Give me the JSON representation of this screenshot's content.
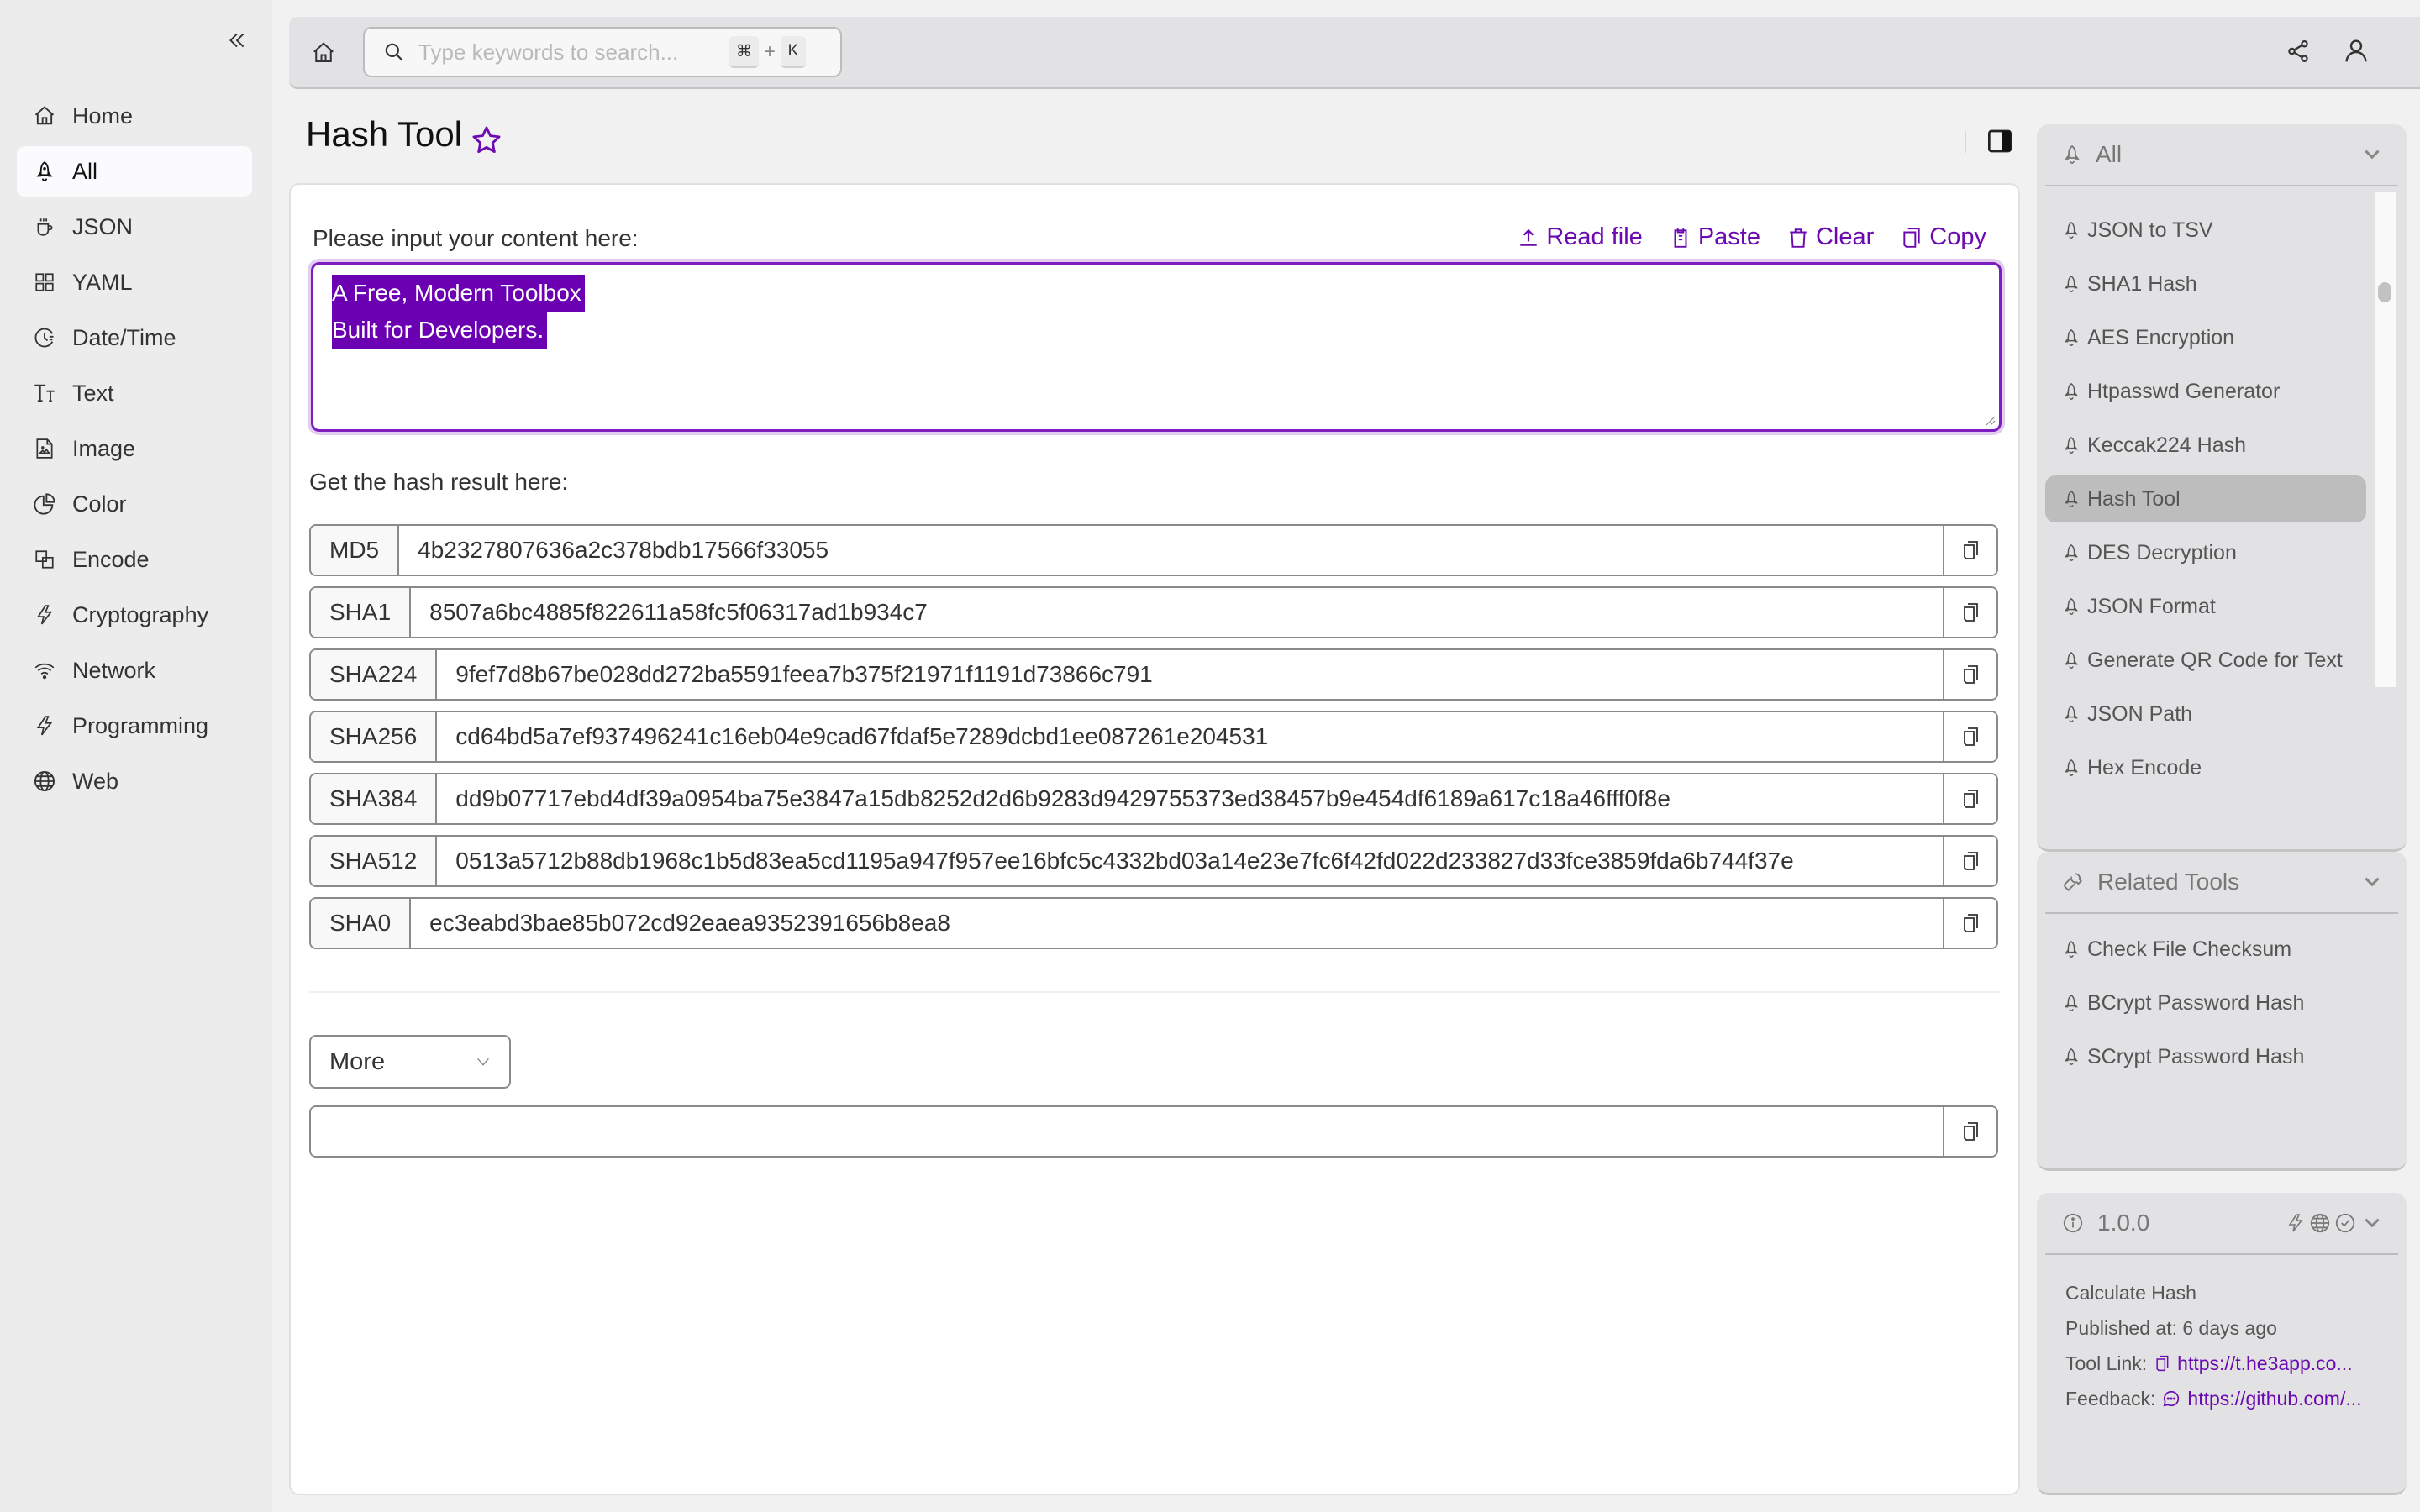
{
  "sidebar": {
    "collapse_icon": "double-chevron-left-icon",
    "items": [
      {
        "label": "Home",
        "icon": "home-icon",
        "active": false
      },
      {
        "label": "All",
        "icon": "rocket-icon",
        "active": true
      },
      {
        "label": "JSON",
        "icon": "coffee-cup-icon",
        "active": false
      },
      {
        "label": "YAML",
        "icon": "grid-icon",
        "active": false
      },
      {
        "label": "Date/Time",
        "icon": "clock-icon",
        "active": false
      },
      {
        "label": "Text",
        "icon": "text-size-icon",
        "active": false
      },
      {
        "label": "Image",
        "icon": "image-file-icon",
        "active": false
      },
      {
        "label": "Color",
        "icon": "pie-chart-icon",
        "active": false
      },
      {
        "label": "Encode",
        "icon": "overlap-squares-icon",
        "active": false
      },
      {
        "label": "Cryptography",
        "icon": "lightning-icon",
        "active": false
      },
      {
        "label": "Network",
        "icon": "wifi-icon",
        "active": false
      },
      {
        "label": "Programming",
        "icon": "lightning-icon",
        "active": false
      },
      {
        "label": "Web",
        "icon": "globe-icon",
        "active": false
      }
    ]
  },
  "topbar": {
    "search_placeholder": "Type keywords to search...",
    "search_value": "",
    "shortcut_key1": "⌘",
    "shortcut_plus": "+",
    "shortcut_key2": "K"
  },
  "page": {
    "title": "Hash Tool",
    "favorited": false
  },
  "input": {
    "label": "Please input your content here:",
    "lines": [
      "A Free, Modern Toolbox",
      "Built for Developers."
    ],
    "actions": {
      "read_file": "Read file",
      "paste": "Paste",
      "clear": "Clear",
      "copy": "Copy"
    }
  },
  "results": {
    "label": "Get the hash result here:",
    "hashes": [
      {
        "name": "MD5",
        "value": "4b2327807636a2c378bdb17566f33055"
      },
      {
        "name": "SHA1",
        "value": "8507a6bc4885f822611a58fc5f06317ad1b934c7"
      },
      {
        "name": "SHA224",
        "value": "9fef7d8b67be028dd272ba5591feea7b375f21971f1191d73866c791"
      },
      {
        "name": "SHA256",
        "value": "cd64bd5a7ef937496241c16eb04e9cad67fdaf5e7289dcbd1ee087261e204531"
      },
      {
        "name": "SHA384",
        "value": "dd9b07717ebd4df39a0954ba75e3847a15db8252d2d6b9283d9429755373ed38457b9e454df6189a617c18a46fff0f8e"
      },
      {
        "name": "SHA512",
        "value": "0513a5712b88db1968c1b5d83ea5cd1195a947f957ee16bfc5c4332bd03a14e23e7fc6f42fd022d233827d33fce3859fda6b744f37e"
      },
      {
        "name": "SHA0",
        "value": "ec3eabd3bae85b072cd92eaea9352391656b8ea8"
      }
    ],
    "more_select": "More",
    "more_value": ""
  },
  "right_panel": {
    "all": {
      "title": "All",
      "items": [
        {
          "label": "JSON to TSV",
          "active": false
        },
        {
          "label": "SHA1 Hash",
          "active": false
        },
        {
          "label": "AES Encryption",
          "active": false
        },
        {
          "label": "Htpasswd Generator",
          "active": false
        },
        {
          "label": "Keccak224 Hash",
          "active": false
        },
        {
          "label": "Hash Tool",
          "active": true
        },
        {
          "label": "DES Decryption",
          "active": false
        },
        {
          "label": "JSON Format",
          "active": false
        },
        {
          "label": "Generate QR Code for Text",
          "active": false
        },
        {
          "label": "JSON Path",
          "active": false
        },
        {
          "label": "Hex Encode",
          "active": false
        }
      ]
    },
    "related": {
      "title": "Related Tools",
      "items": [
        {
          "label": "Check File Checksum"
        },
        {
          "label": "BCrypt Password Hash"
        },
        {
          "label": "SCrypt Password Hash"
        }
      ]
    },
    "info": {
      "version": "1.0.0",
      "description": "Calculate Hash",
      "published": "Published at: 6 days ago",
      "tool_link_label": "Tool Link:",
      "tool_link": "https://t.he3app.co...",
      "feedback_label": "Feedback:",
      "feedback_link": "https://github.com/..."
    }
  },
  "colors": {
    "accent": "#6b0ab1",
    "selection": "#6b00b3",
    "sidebar_bg": "#ececec",
    "panel_bg": "#e2e2e4"
  }
}
